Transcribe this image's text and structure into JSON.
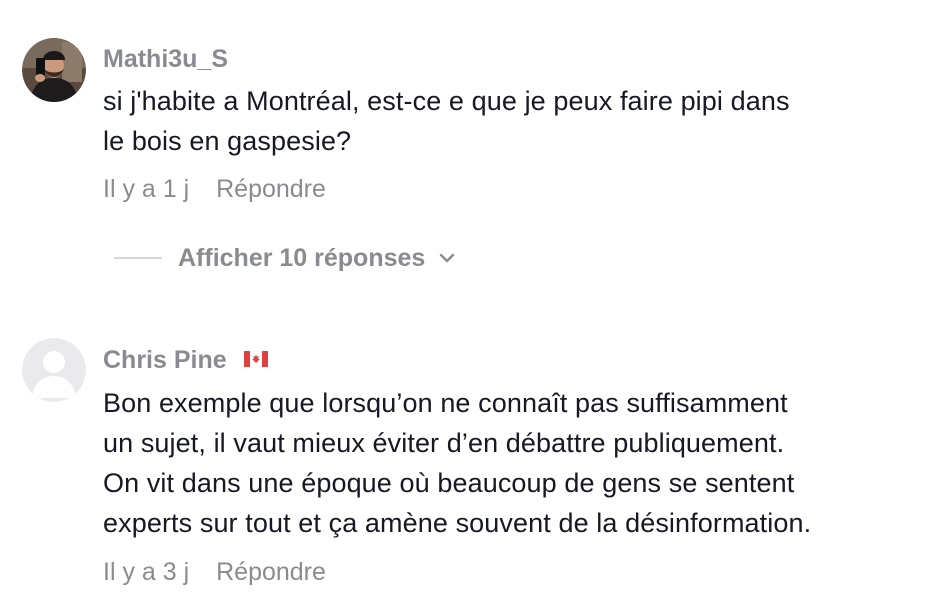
{
  "comments": [
    {
      "username": "Mathi3u_S",
      "avatar_icon": "user-photo-avatar",
      "lines": [
        "si j'habite a Montréal, est-ce e que je peux faire pipi dans",
        "le bois en gaspesie?"
      ],
      "time": "Il y a 1 j",
      "reply_label": "Répondre",
      "replies_toggle": {
        "label": "Afficher 10 réponses",
        "icon": "chevron-down-icon"
      }
    },
    {
      "username": "Chris Pine",
      "badge_icon": "canada-flag-icon",
      "avatar_icon": "default-avatar-icon",
      "lines": [
        "Bon exemple que lorsqu’on ne connaît pas suffisamment",
        "un sujet, il vaut mieux éviter d’en débattre publiquement.",
        "On vit dans une époque où beaucoup de gens se sentent",
        "experts sur tout et ça amène souvent de la désinformation."
      ],
      "time": "Il y a 3 j",
      "reply_label": "Répondre"
    }
  ],
  "colors": {
    "text": "#161823",
    "muted": "#8a8b91",
    "divider": "#d6d7da",
    "default_avatar_bg": "#eaeaec",
    "flag_red": "#e0413f"
  }
}
